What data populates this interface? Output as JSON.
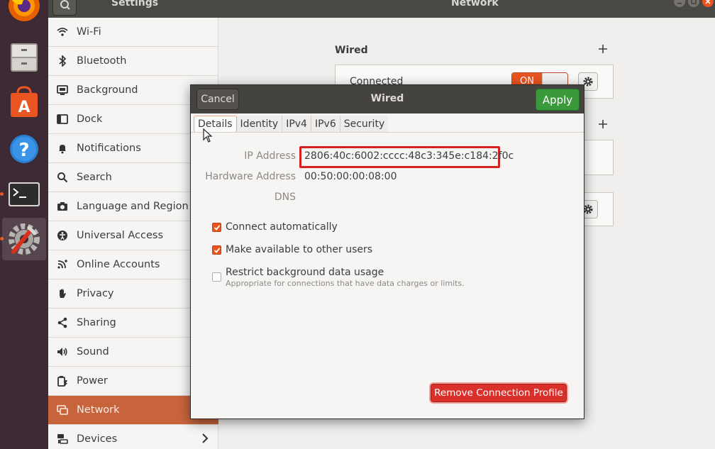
{
  "topbar": {
    "settings_title": "Settings",
    "network_title": "Network"
  },
  "dock": {
    "apps": [
      "firefox-icon",
      "files-icon",
      "software-center-icon",
      "help-icon",
      "terminal-icon",
      "settings-icon"
    ]
  },
  "sidebar": {
    "items": [
      {
        "label": "Wi-Fi",
        "icon": "wifi-icon"
      },
      {
        "label": "Bluetooth",
        "icon": "bluetooth-icon"
      },
      {
        "label": "Background",
        "icon": "background-icon"
      },
      {
        "label": "Dock",
        "icon": "dock-icon"
      },
      {
        "label": "Notifications",
        "icon": "bell-icon"
      },
      {
        "label": "Search",
        "icon": "search-icon"
      },
      {
        "label": "Language and Region",
        "icon": "camera-icon"
      },
      {
        "label": "Universal Access",
        "icon": "accessibility-icon"
      },
      {
        "label": "Online Accounts",
        "icon": "online-accounts-icon"
      },
      {
        "label": "Privacy",
        "icon": "hand-icon"
      },
      {
        "label": "Sharing",
        "icon": "share-icon"
      },
      {
        "label": "Sound",
        "icon": "speaker-icon"
      },
      {
        "label": "Power",
        "icon": "power-icon"
      },
      {
        "label": "Network",
        "icon": "network-icon",
        "selected": true
      },
      {
        "label": "Devices",
        "icon": "devices-icon"
      }
    ]
  },
  "main": {
    "wired_title": "Wired",
    "connected_label": "Connected",
    "toggle_label": "ON"
  },
  "dialog": {
    "title": "Wired",
    "cancel_label": "Cancel",
    "apply_label": "Apply",
    "tabs": [
      "Details",
      "Identity",
      "IPv4",
      "IPv6",
      "Security"
    ],
    "active_tab": "Details",
    "ip_label": "IP Address",
    "ip_value": "2806:40c:6002:cccc:48c3:345e:c184:2f0c",
    "hw_label": "Hardware Address",
    "hw_value": "00:50:00:00:08:00",
    "dns_label": "DNS",
    "connect_auto_label": "Connect automatically",
    "connect_auto_checked": true,
    "available_users_label": "Make available to other users",
    "available_users_checked": true,
    "restrict_label": "Restrict background data usage",
    "restrict_sub": "Appropriate for connections that have data charges or limits.",
    "restrict_checked": false,
    "remove_label": "Remove Connection Profile"
  },
  "colors": {
    "accent": "#e95420",
    "selected_row": "#c8643c",
    "apply_green": "#3a9a3b",
    "remove_red": "#d9302a",
    "highlight_red": "#d42222"
  }
}
